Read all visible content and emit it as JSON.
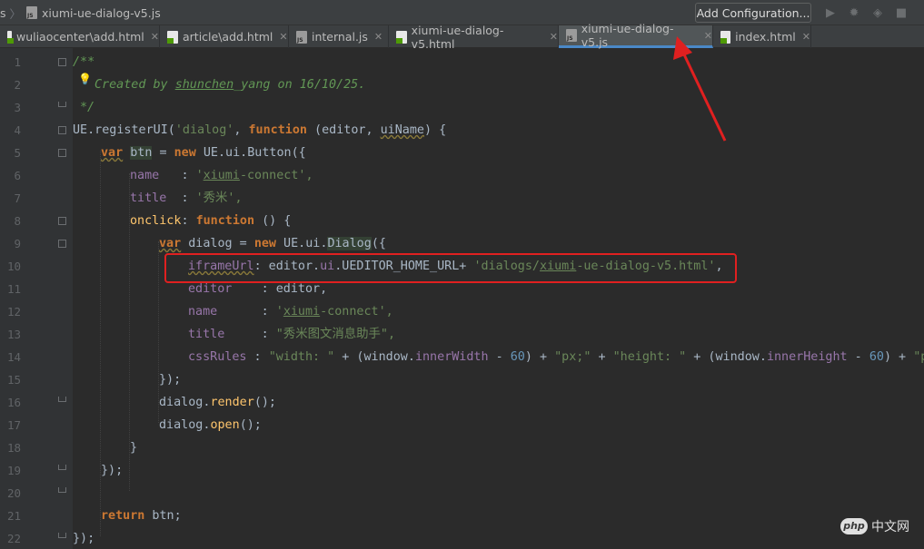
{
  "breadcrumb": {
    "prefix": "s",
    "file": "xiumi-ue-dialog-v5.js"
  },
  "toolbar": {
    "add_configuration": "Add Configuration..."
  },
  "tabs": [
    {
      "label": "wuliaocenter\\add.html",
      "type": "html"
    },
    {
      "label": "article\\add.html",
      "type": "html"
    },
    {
      "label": "internal.js",
      "type": "js"
    },
    {
      "label": "xiumi-ue-dialog-v5.html",
      "type": "html"
    },
    {
      "label": "xiumi-ue-dialog-v5.js",
      "type": "js",
      "active": true
    },
    {
      "label": "index.html",
      "type": "html"
    }
  ],
  "line_numbers": [
    "1",
    "2",
    "3",
    "4",
    "5",
    "6",
    "7",
    "8",
    "9",
    "10",
    "11",
    "12",
    "13",
    "14",
    "15",
    "16",
    "17",
    "18",
    "19",
    "20",
    "21",
    "22"
  ],
  "code": {
    "l1": "/**",
    "l2": {
      "pre": "Created by ",
      "author": "shunchen",
      "post": "_yang on 16/10/25."
    },
    "l3": "*/",
    "l4": {
      "obj": "UE",
      "call": ".registerUI(",
      "name": "'dialog'",
      "comma": ", ",
      "kw": "function",
      "args_open": " (editor, ",
      "arg2": "uiName",
      "args_close": ") {"
    },
    "l5": {
      "kw": "var",
      "sp": " ",
      "var": "btn",
      "eq": " = ",
      "kw2": "new",
      "rest": " UE.ui.Button({"
    },
    "l6": {
      "key": "name   ",
      "colon": ": ",
      "val_q": "'",
      "val_u": "xiumi",
      "val_rest": "-connect',"
    },
    "l7": {
      "key": "title  ",
      "colon": ": ",
      "val": "'秀米',"
    },
    "l8": {
      "key": "onclick",
      "colon": ": ",
      "kw": "function",
      "rest": " () {"
    },
    "l9": {
      "kw": "var",
      "rest1": " dialog = ",
      "kw2": "new",
      "rest2": " UE.ui.",
      "cls": "Dialog",
      "rest3": "({"
    },
    "l10": {
      "key": "iframeUrl",
      "colon": ": editor.",
      "prop": "ui",
      "mid": ".UEDITOR_HOME_URL+ ",
      "str_a": "'dialogs/",
      "str_u": "xiumi",
      "str_b": "-ue-dialog-v5.html'",
      "end": ","
    },
    "l11": {
      "key": "editor   ",
      "rest": " : editor,"
    },
    "l12": {
      "key": "name     ",
      "colon": " : ",
      "val_q": "'",
      "val_u": "xiumi",
      "val_rest": "-connect',"
    },
    "l13": {
      "key": "title    ",
      "colon": " : ",
      "val": "\"秀米图文消息助手\","
    },
    "l14": {
      "key": "cssRules",
      "colon": " : ",
      "s1": "\"width: \"",
      "p1": " + (window.",
      "prop1": "innerWidth",
      "m1": " - ",
      "n1": "60",
      "p2": ") + ",
      "s2": "\"px;\"",
      "p3": " + ",
      "s3": "\"height: \"",
      "p4": " + (window.",
      "prop2": "innerHeight",
      "m2": " - ",
      "n2": "60",
      "p5": ") + ",
      "s4": "\"px;\""
    },
    "l15": "});",
    "l16": {
      "obj": "dialog.",
      "fn": "render",
      "rest": "();"
    },
    "l17": {
      "obj": "dialog.",
      "fn": "open",
      "rest": "();"
    },
    "l18": "}",
    "l19": "});",
    "l21": {
      "kw": "return",
      "rest": " btn;"
    },
    "l22": "});"
  },
  "watermark": {
    "logo": "php",
    "text": "中文网"
  },
  "colors": {
    "annotation_box": "#e02020",
    "arrow": "#e02020",
    "active_tab_underline": "#4a88c7"
  }
}
